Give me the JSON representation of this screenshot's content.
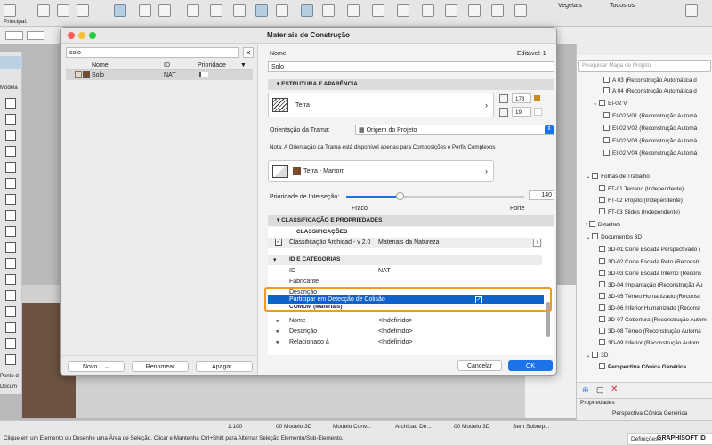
{
  "toolbar": {
    "principal": "Principal:",
    "vegetais": "Vegetais",
    "todos": "Todos os"
  },
  "leftbar": {
    "modelar": "Modela",
    "ponto": "Ponto d",
    "docum": "Docum"
  },
  "dialog": {
    "title": "Materiais de Construção",
    "search_value": "solo",
    "list": {
      "headers": [
        "Nome",
        "ID",
        "Prioridade"
      ],
      "rows": [
        {
          "name": "Solo",
          "id": "NAT"
        }
      ]
    },
    "buttons": {
      "novo": "Novo...",
      "renomear": "Renomear",
      "apagar": "Apagar...",
      "cancelar": "Cancelar",
      "ok": "OK"
    },
    "name_label": "Nome:",
    "editavel": "Editável: 1",
    "name_value": "Solo",
    "sec_estrutura": "ESTRUTURA E APARÊNCIA",
    "fill_name": "Terra",
    "pen_a": "173",
    "pen_b": "19",
    "orientacao_label": "Orientação da Trama:",
    "orientacao_value": "Origem do Projeto",
    "nota": "Nota: A Orientação da Trama está disponível apenas para Composições e Perfis Complexos",
    "surface_name": "Terra - Marrom",
    "prioridade_label": "Prioridade de Interseção:",
    "prioridade_value": "140",
    "prioridade_level": 0.3,
    "fraco": "Fraco",
    "forte": "Forte",
    "sec_class": "CLASSIFICAÇÃO E PROPRIEDADES",
    "classificacoes": "CLASSIFICAÇÕES",
    "class_name": "Classificação Archicad - v 2.0",
    "class_value": "Materiais da Natureza",
    "id_cat": "ID E CATEGORIAS",
    "props": [
      {
        "k": "ID",
        "v": "NAT"
      },
      {
        "k": "Fabricante",
        "v": ""
      },
      {
        "k": "Descrição",
        "v": ""
      }
    ],
    "highlight": "Participar em Detecção de Colisão",
    "comum": "COMUM (Materiais)",
    "comum_props": [
      {
        "k": "Nome",
        "v": "<Indefinido>"
      },
      {
        "k": "Descrição",
        "v": "<Indefinido>"
      },
      {
        "k": "Relacionado à",
        "v": "<Indefinido>"
      }
    ],
    "colors": {
      "highlight": "#0f62c9",
      "orange": "#f39a1c",
      "ok": "#1a73e8"
    }
  },
  "navigator": {
    "search": "Pesquisar Mapa de Projeto",
    "items": [
      "A 03 (Reconstrução Automática d",
      "A 04 (Reconstrução Automática d",
      "EI-02 V",
      "EI-02 V01 (Reconstrução Automá",
      "EI-02 V02 (Reconstrução Automá",
      "EI-02 V03 (Reconstrução Automá",
      "EI-02 V04 (Reconstrução Automá",
      "Folhas de Trabalho",
      "FT-01 Terreno (Independente)",
      "FT-02 Projeto (Independente)",
      "FT-03 Slides (Independente)",
      "Detalhes",
      "Documentos 3D",
      "3D-01 Corte Escada Perspectivado (",
      "3D-02 Corte Escada Reto (Reconstr",
      "3D-03 Corte Escada Interno (Recons",
      "3D-04 Implantação (Reconstrução Au",
      "3D-05 Térreo Humanizado (Reconst",
      "3D-06 Inferior Humanizado (Reconst",
      "3D-07 Cobertura (Reconstrução Autom",
      "3D-08 Térreo (Reconstrução Automá",
      "3D-09 Inferior (Reconstrução Autom",
      "3D",
      "Perspectiva Cônica Genérica"
    ],
    "propriedades": "Propriedades",
    "prop_value": "Perspectiva Cônica Genérica",
    "definicoes": "Definições..."
  },
  "statusbar": {
    "scale": "1:100",
    "modelo": "00 Modelo 3D",
    "modelo_conv": "Modelo Conv...",
    "archicad": "Archicad De...",
    "modelo3d": "00 Modelo 3D",
    "sem": "Sem Sobrep...",
    "hint": "Clique em um Elemento ou Desenhe uma Área de Seleção. Clicar e Mantenha Ctrl+Shift para Alternar Seleção Elemento/Sub-Elemento.",
    "brand": "GRAPHISOFT ID"
  }
}
